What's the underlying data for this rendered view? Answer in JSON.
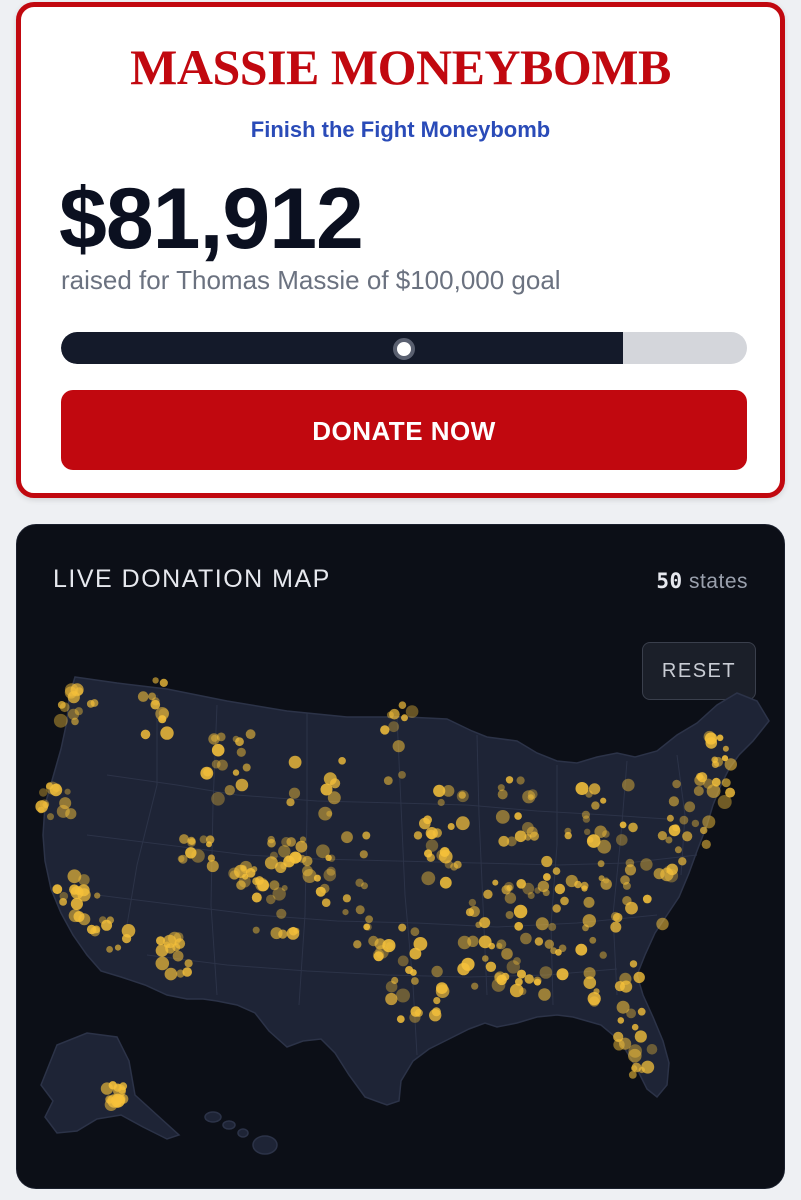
{
  "campaign": {
    "title": "MASSIE MONEYBOMB",
    "subtitle": "Finish the Fight Moneybomb",
    "amount": "$81,912",
    "raised_text": "raised for Thomas Massie of $100,000 goal",
    "progress_fraction": 0.819,
    "donate_label": "DONATE NOW"
  },
  "map": {
    "title": "LIVE DONATION MAP",
    "states_count": "50",
    "states_label": "states",
    "reset_label": "RESET",
    "dot_color": "#f6c13a"
  },
  "colors": {
    "accent_red": "#c1080f",
    "subtitle_blue": "#2a4bb8",
    "map_bg": "#0c0f17",
    "land": "#1e2436"
  }
}
